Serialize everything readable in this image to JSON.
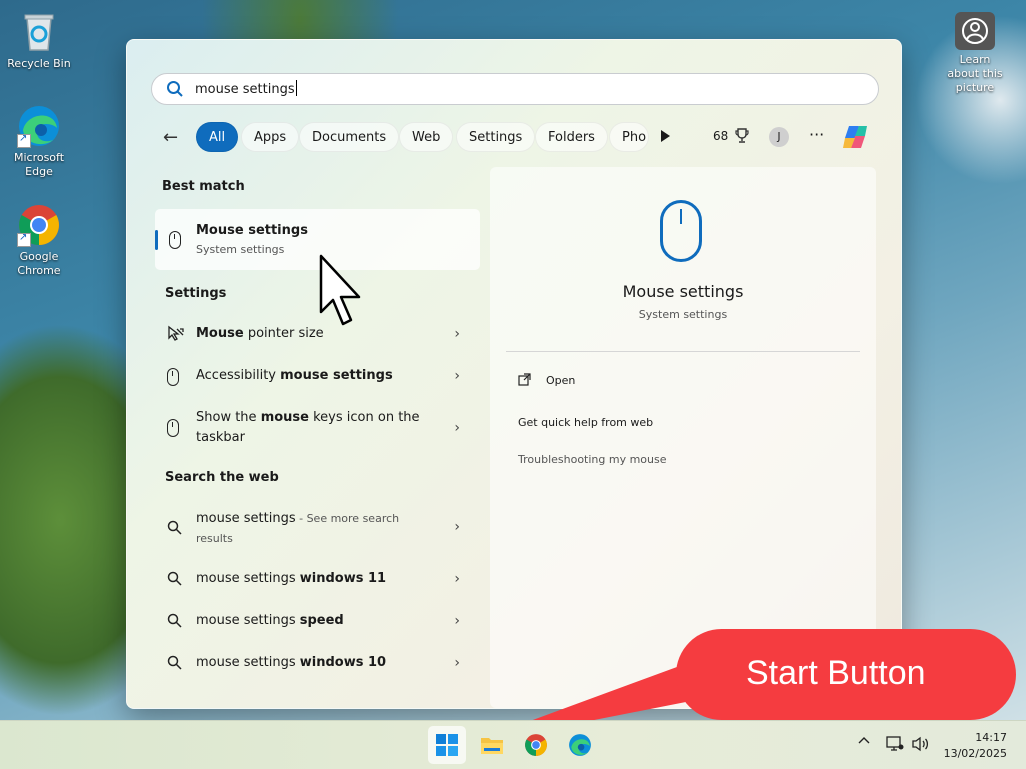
{
  "desktop": {
    "icons": [
      {
        "label": "Recycle Bin"
      },
      {
        "label": "Microsoft Edge"
      },
      {
        "label": "Google Chrome"
      }
    ],
    "learn_label": "Learn about this picture"
  },
  "search": {
    "query": "mouse settings"
  },
  "filters": {
    "chips": [
      "All",
      "Apps",
      "Documents",
      "Web",
      "Settings",
      "Folders",
      "Pho"
    ],
    "active": "All",
    "points": "68",
    "avatar_initial": "J",
    "more": "···"
  },
  "results": {
    "best_match_header": "Best match",
    "best_match": {
      "title": "Mouse settings",
      "subtitle": "System settings"
    },
    "settings_header": "Settings",
    "settings_items": [
      {
        "pre": "",
        "bold": "Mouse",
        "post": " pointer size"
      },
      {
        "pre": "Accessibility ",
        "bold": "mouse settings",
        "post": ""
      },
      {
        "pre": "Show the ",
        "bold": "mouse",
        "post": " keys icon on the taskbar"
      }
    ],
    "web_header": "Search the web",
    "web_items": [
      {
        "pre": "mouse settings",
        "bold": "",
        "extra": " - See more search results"
      },
      {
        "pre": "mouse settings ",
        "bold": "windows 11",
        "extra": ""
      },
      {
        "pre": "mouse settings ",
        "bold": "speed",
        "extra": ""
      },
      {
        "pre": "mouse settings ",
        "bold": "windows 10",
        "extra": ""
      }
    ]
  },
  "preview": {
    "title": "Mouse settings",
    "subtitle": "System settings",
    "open_label": "Open",
    "help_label": "Get quick help from web",
    "link_label": "Troubleshooting my mouse"
  },
  "callout": {
    "text": "Start Button",
    "color": "#f53c40"
  },
  "taskbar": {
    "time": "14:17",
    "date": "13/02/2025"
  },
  "colors": {
    "accent": "#0f6cbd"
  }
}
